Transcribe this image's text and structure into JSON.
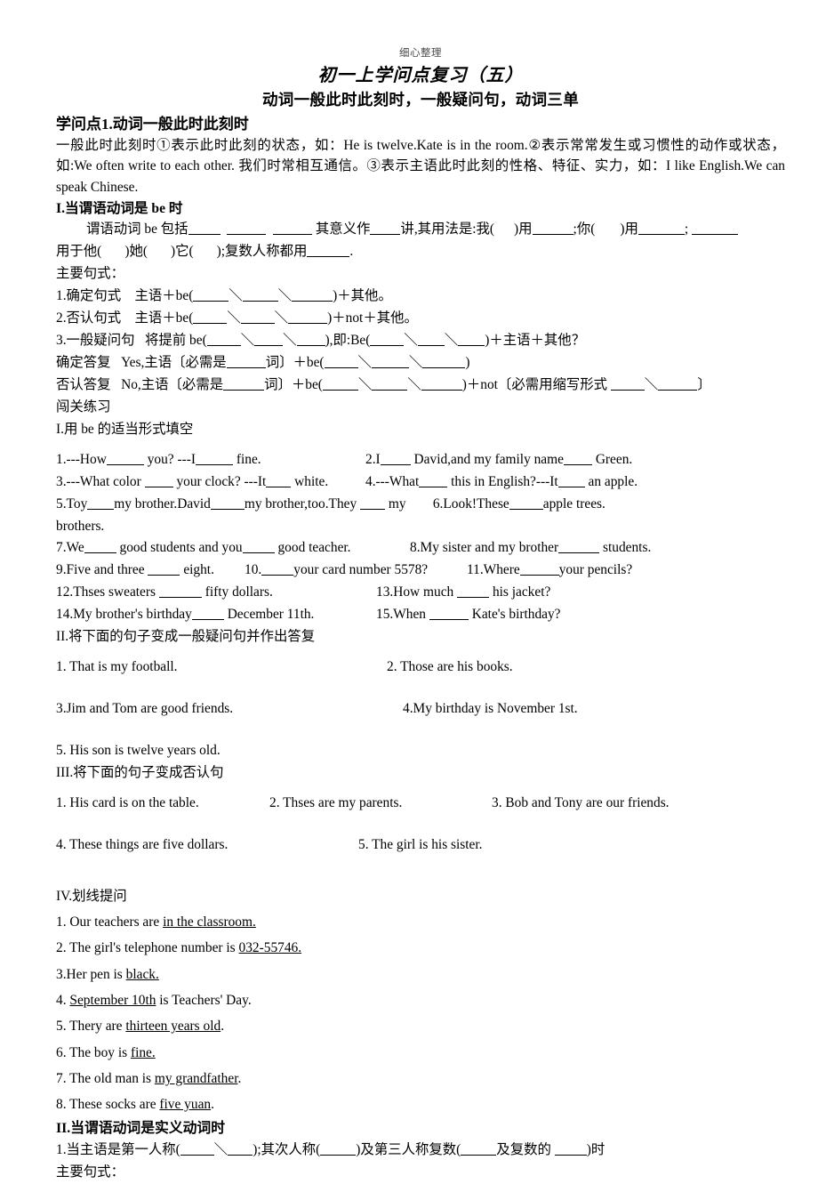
{
  "page": {
    "watermark": "细心整理",
    "title": "初一上学问点复习（五）",
    "subtitle": "动词一般此时此刻时，一般疑问句，动词三单"
  },
  "section_kp1": {
    "heading": "学问点1.动词一般此时此刻时",
    "intro": "一般此时此刻时①表示此时此刻的状态，如：He is twelve.Kate is in the room.②表示常常发生或习惯性的动作或状态，如:We often write to each other. 我们时常相互通信。③表示主语此时此刻的性格、特征、实力，如：I like English.We can speak Chinese.",
    "sub_heading": "I.当谓语动词是 be 时"
  },
  "be_forms": {
    "line1_a": "谓语动词 be 包括",
    "line1_b": "其意义作",
    "line1_c": "讲,其用法是:我(",
    "line1_d": ")用",
    "line1_e": ";你(",
    "line1_f": ")用",
    "line2_a": "用于他(",
    "line2_b": ")她(",
    "line2_c": ")它(",
    "line2_d": ");复数人称都用",
    "line2_e": "."
  },
  "patterns": {
    "title": "主要句式：",
    "p1_a": "1.确定句式    主语＋be(",
    "p1_b": "＼",
    "p1_c": "＼",
    "p1_d": ")＋其他。",
    "p2_a": "2.否认句式    主语＋be(",
    "p2_b": ")＋not＋其他。",
    "p3_a": "3.一般疑问句   将提前 be(",
    "p3_b": "),即:Be(",
    "p3_c": ")＋主语＋其他？",
    "aff_a": "确定答复   Yes,主语〔必需是",
    "aff_b": "词〕＋be(",
    "aff_c": ")",
    "neg_a": "否认答复   No,主语〔必需是",
    "neg_b": "词〕＋be(",
    "neg_c": ")＋not〔必需用缩写形式",
    "neg_d": "〕"
  },
  "practice": {
    "title": "闯关练习",
    "part1_heading": "I.用 be 的适当形式填空",
    "items": [
      {
        "n": "1.",
        "pre": "---How",
        "mid": "you? ---I",
        "post": "fine."
      },
      {
        "n": "2.",
        "pre": "I",
        "mid": "David,and my family name",
        "post": "Green."
      },
      {
        "n": "3.",
        "pre": "---What color",
        "mid": "your clock? ---It",
        "post": "white."
      },
      {
        "n": "4.",
        "pre": "---What",
        "mid": "this in English?---It",
        "post": "an apple."
      },
      {
        "n": "5.",
        "pre": "Toy",
        "mid": "my brother.David",
        "mid2": "my brother,too.They",
        "post": "my brothers."
      },
      {
        "n": "6.",
        "pre": "Look!These",
        "post": "apple trees."
      },
      {
        "n": "7.",
        "pre": "We",
        "mid": "good students and you",
        "post": "good teacher."
      },
      {
        "n": "8.",
        "pre": "My sister and my brother",
        "post": "students."
      },
      {
        "n": "9.",
        "pre": "Five and three",
        "post": "eight."
      },
      {
        "n": "10.",
        "pre": "",
        "post": "your card number 5578?"
      },
      {
        "n": "11.",
        "pre": "Where",
        "post": "your pencils?"
      },
      {
        "n": "12.",
        "pre": "Thses sweaters",
        "post": "fifty dollars."
      },
      {
        "n": "13.",
        "pre": "How much",
        "post": "his jacket?"
      },
      {
        "n": "14.",
        "pre": "My brother's birthday",
        "post": "December 11th."
      },
      {
        "n": "15.",
        "pre": "When",
        "post": "Kate's birthday?"
      }
    ]
  },
  "part2": {
    "heading": "II.将下面的句子变成一般疑问句并作出答复",
    "items": [
      "1. That is my football.",
      "2. Those are his books.",
      "3.Jim and Tom are good friends.",
      "4.My birthday is November 1st.",
      "5. His son is twelve years old."
    ]
  },
  "part3": {
    "heading": "III.将下面的句子变成否认句",
    "items": [
      "1. His card is on the table.",
      "2. Thses are my parents.",
      "3. Bob and Tony are our friends.",
      "4. These things are five dollars.",
      "5. The girl is his sister."
    ]
  },
  "part4": {
    "heading": "IV.划线提问",
    "items": [
      {
        "pre": "1. Our teachers are ",
        "underline": "in the classroom.",
        "post": ""
      },
      {
        "pre": "2. The girl's telephone number is ",
        "underline": "032-55746.",
        "post": ""
      },
      {
        "pre": "3.Her pen is ",
        "underline": "black.",
        "post": ""
      },
      {
        "pre": "4. ",
        "underline": "September 10th",
        "post": " is Teachers' Day."
      },
      {
        "pre": "5. Thery are ",
        "underline": "thirteen years old",
        "post": "."
      },
      {
        "pre": "6. The boy is ",
        "underline": "fine.",
        "post": ""
      },
      {
        "pre": "7. The old man is ",
        "underline": "my grandfather",
        "post": "."
      },
      {
        "pre": "8. These socks are ",
        "underline": "five yuan",
        "post": "."
      }
    ]
  },
  "section_kp2": {
    "heading": "II.当谓语动词是实义动词时",
    "line1_a": "1.当主语是第一人称(",
    "line1_b": "＼",
    "line1_c": ");其次人称(",
    "line1_d": ")及第三人称复数(",
    "line1_e": "及复数的",
    "line1_f": ")时",
    "patterns_title": "主要句式："
  }
}
